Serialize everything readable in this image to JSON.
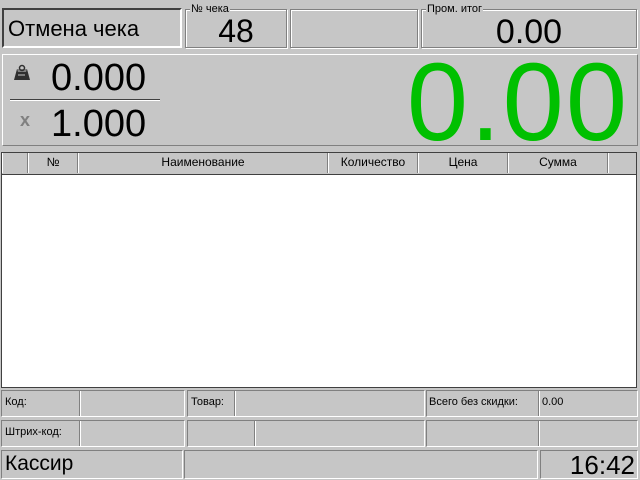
{
  "header": {
    "mode_label": "Отмена чека",
    "check_number_label": "№ чека",
    "check_number": "48",
    "subtotal_label": "Пром. итог",
    "subtotal": "0.00"
  },
  "quantity_panel": {
    "weight_value": "0.000",
    "multiplier_symbol": "x",
    "multiplier_value": "1.000",
    "total": "0.00",
    "total_color": "#00c000"
  },
  "table": {
    "columns": [
      "№",
      "Наименование",
      "Количество",
      "Цена",
      "Сумма"
    ],
    "rows": []
  },
  "bottom": {
    "code_label": "Код:",
    "code_value": "",
    "product_label": "Товар:",
    "product_value": "",
    "total_no_discount_label": "Всего без скидки:",
    "total_no_discount_value": "0.00",
    "barcode_label": "Штрих-код:",
    "barcode_value": ""
  },
  "status": {
    "user": "Кассир",
    "time": "16:42"
  },
  "icons": {
    "weight": "scale-weight-icon",
    "multiply": "multiply-icon"
  }
}
